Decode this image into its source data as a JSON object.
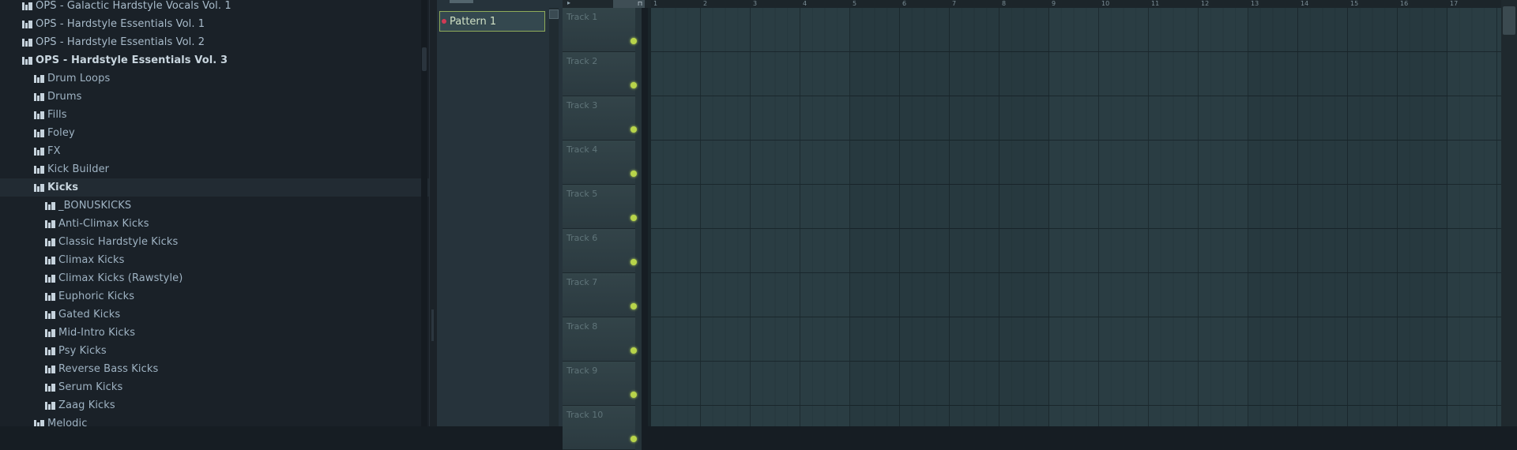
{
  "browser": {
    "items": [
      {
        "label": "OPS - Galactic Hardstyle Vocals Vol. 1",
        "level": 0,
        "kind": "pack"
      },
      {
        "label": "OPS - Hardstyle Essentials Vol. 1",
        "level": 0,
        "kind": "pack"
      },
      {
        "label": "OPS - Hardstyle Essentials Vol. 2",
        "level": 0,
        "kind": "pack"
      },
      {
        "label": "OPS - Hardstyle Essentials Vol. 3",
        "level": 0,
        "kind": "open"
      },
      {
        "label": "Drum Loops",
        "level": 1,
        "kind": "folder"
      },
      {
        "label": "Drums",
        "level": 1,
        "kind": "folder"
      },
      {
        "label": "Fills",
        "level": 1,
        "kind": "folder"
      },
      {
        "label": "Foley",
        "level": 1,
        "kind": "folder"
      },
      {
        "label": "FX",
        "level": 1,
        "kind": "folder"
      },
      {
        "label": "Kick Builder",
        "level": 1,
        "kind": "folder"
      },
      {
        "label": "Kicks",
        "level": 1,
        "kind": "open"
      },
      {
        "label": "_BONUSKICKS",
        "level": 2,
        "kind": "folder"
      },
      {
        "label": "Anti-Climax Kicks",
        "level": 2,
        "kind": "folder"
      },
      {
        "label": "Classic Hardstyle Kicks",
        "level": 2,
        "kind": "folder"
      },
      {
        "label": "Climax Kicks",
        "level": 2,
        "kind": "folder"
      },
      {
        "label": "Climax Kicks (Rawstyle)",
        "level": 2,
        "kind": "folder"
      },
      {
        "label": "Euphoric Kicks",
        "level": 2,
        "kind": "folder"
      },
      {
        "label": "Gated Kicks",
        "level": 2,
        "kind": "folder"
      },
      {
        "label": "Mid-Intro Kicks",
        "level": 2,
        "kind": "folder"
      },
      {
        "label": "Psy Kicks",
        "level": 2,
        "kind": "folder"
      },
      {
        "label": "Reverse Bass Kicks",
        "level": 2,
        "kind": "folder"
      },
      {
        "label": "Serum Kicks",
        "level": 2,
        "kind": "folder"
      },
      {
        "label": "Zaag Kicks",
        "level": 2,
        "kind": "folder"
      },
      {
        "label": "Melodic",
        "level": 1,
        "kind": "folder"
      }
    ]
  },
  "patterns": {
    "selected_label": "Pattern 1"
  },
  "playlist": {
    "tracks": [
      "Track 1",
      "Track 2",
      "Track 3",
      "Track 4",
      "Track 5",
      "Track 6",
      "Track 7",
      "Track 8",
      "Track 9",
      "Track 10"
    ],
    "bar_numbers": [
      "1",
      "2",
      "3",
      "4",
      "5",
      "6",
      "7",
      "8",
      "9",
      "10",
      "11",
      "12",
      "13",
      "14",
      "15",
      "16",
      "17"
    ]
  },
  "colors": {
    "pattern_dot": "#d13a55",
    "pattern_border": "#8fab5a",
    "track_led": "#b8d44a"
  },
  "icons": {
    "folder": "folder-icon",
    "snap": "magnet-icon",
    "menu": "menu-arrow-icon"
  }
}
